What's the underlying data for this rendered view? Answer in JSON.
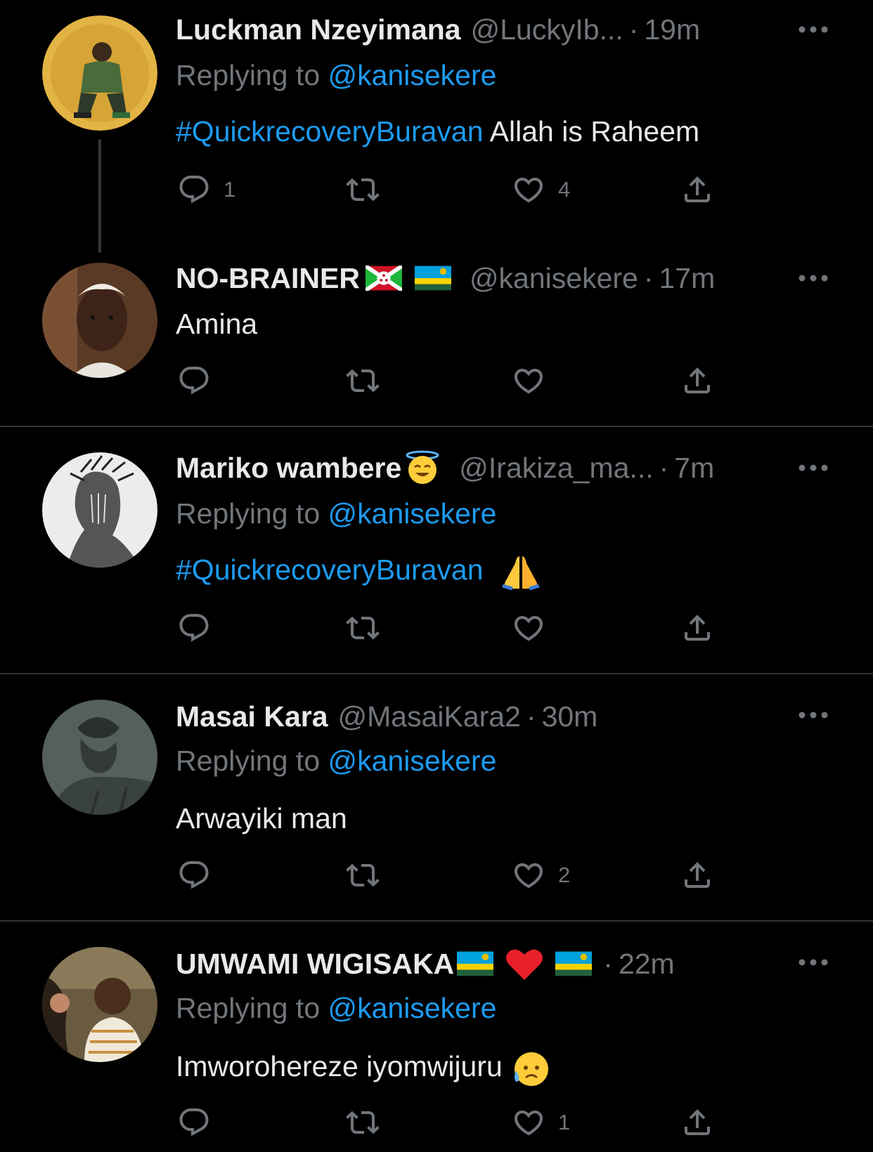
{
  "colors": {
    "background": "#000000",
    "text": "#e7e9ea",
    "muted": "#71767b",
    "link": "#1d9bf0",
    "divider": "#2f3336"
  },
  "icons": {
    "reply": "speech-bubble-icon",
    "retweet": "retweet-icon",
    "like": "heart-icon",
    "share": "share-upload-icon",
    "more": "ellipsis-icon"
  },
  "tweets": [
    {
      "name": "Luckman Nzeyimana",
      "handle": "@LuckyIb...",
      "time": "19m",
      "replying_prefix": "Replying to ",
      "replying_to": "@kanisekere",
      "hashtag": "#QuickrecoveryBuravan",
      "text": " Allah is Raheem",
      "replies": "1",
      "likes": "4"
    },
    {
      "name": "NO-BRAINER",
      "handle": "@kanisekere",
      "time": "17m",
      "text": "Amina"
    },
    {
      "name": "Mariko wambere",
      "handle": "@Irakiza_ma...",
      "time": "7m",
      "replying_prefix": "Replying to ",
      "replying_to": "@kanisekere",
      "hashtag": "#QuickrecoveryBuravan"
    },
    {
      "name": "Masai Kara",
      "handle": "@MasaiKara2",
      "time": "30m",
      "replying_prefix": "Replying to ",
      "replying_to": "@kanisekere",
      "text": "Arwayiki man",
      "likes": "2"
    },
    {
      "name": "UMWAMI WIGISAKA",
      "time": "22m",
      "replying_prefix": "Replying to ",
      "replying_to": "@kanisekere",
      "text": "Imworohereze iyomwijuru",
      "likes": "1"
    }
  ]
}
